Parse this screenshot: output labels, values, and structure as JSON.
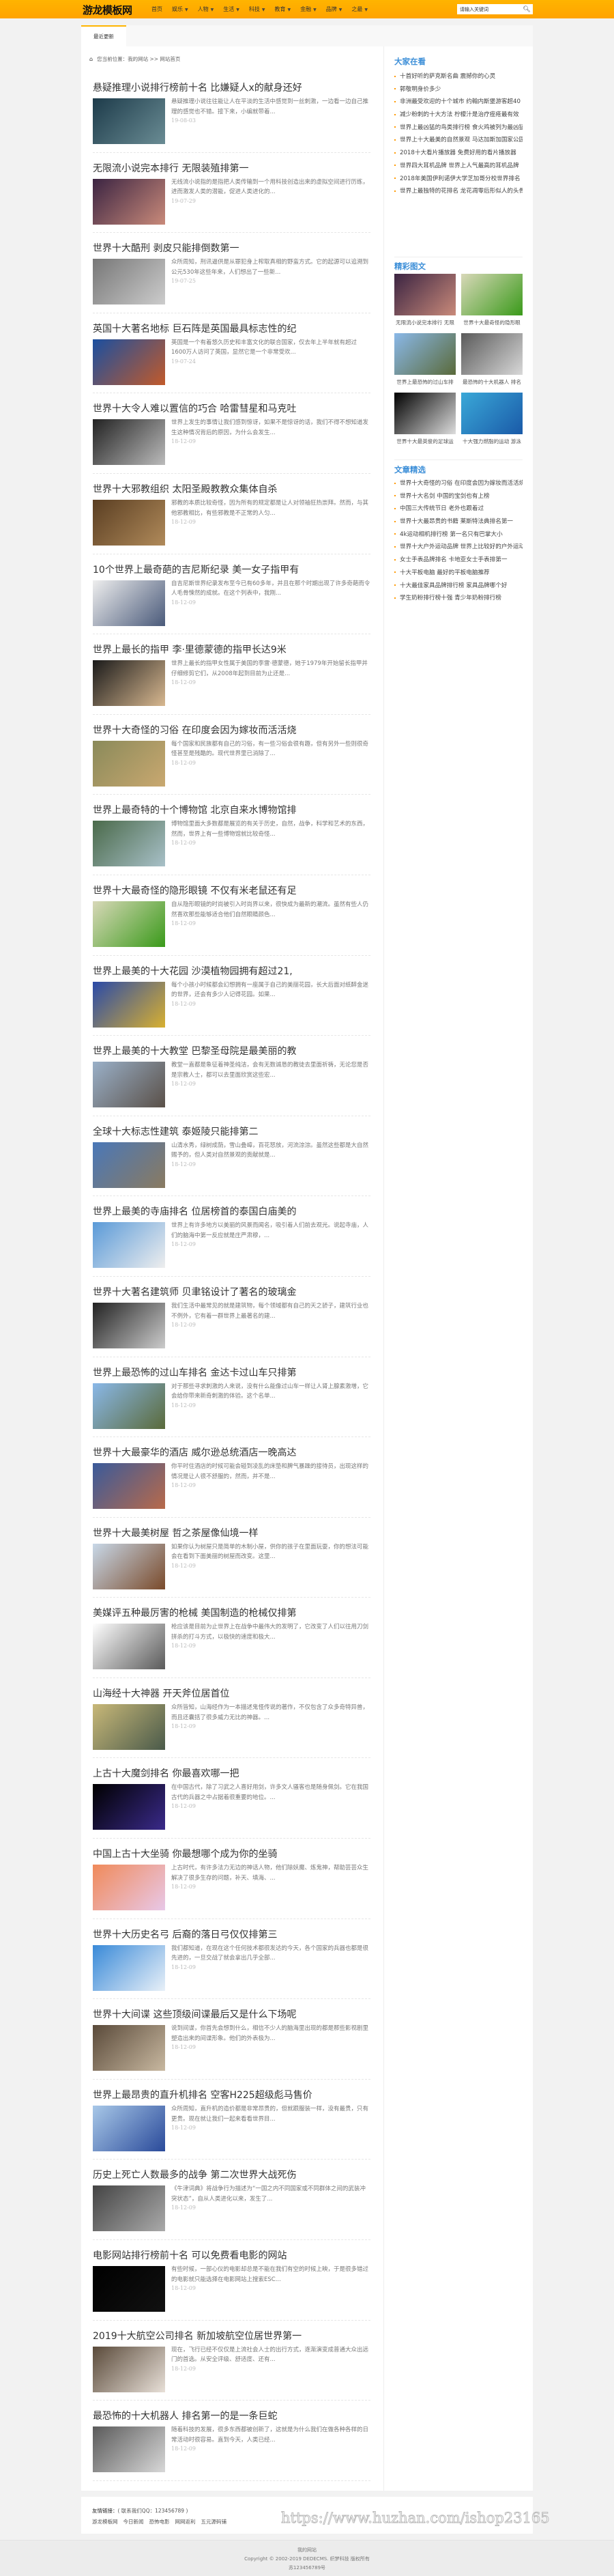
{
  "header": {
    "logo": "游龙模板网",
    "nav": [
      {
        "label": "首页",
        "dropdown": false
      },
      {
        "label": "娱乐",
        "dropdown": true
      },
      {
        "label": "人物",
        "dropdown": true
      },
      {
        "label": "生活",
        "dropdown": true
      },
      {
        "label": "科技",
        "dropdown": true
      },
      {
        "label": "教育",
        "dropdown": true
      },
      {
        "label": "金融",
        "dropdown": true
      },
      {
        "label": "品牌",
        "dropdown": true
      },
      {
        "label": "之最",
        "dropdown": true
      }
    ],
    "search_placeholder": "请输入关键词",
    "accent": "#ffb400"
  },
  "tabs": {
    "active": "最近更新"
  },
  "breadcrumb": {
    "text": "您当前位置：我的网站 >> 网站首页"
  },
  "articles": [
    {
      "title": "悬疑推理小说排行榜前十名 比嫌疑人x的献身还好",
      "excerpt": "悬疑推理小说往往能让人在平淡的生活中感觉到一丝刺激，一边看一边自己推理的感觉也不错。接下来，小编就带着...",
      "date": "19-08-03",
      "colors": [
        "#1d3b4a",
        "#6a8c94"
      ]
    },
    {
      "title": "无限流小说完本排行 无限装殖排第一",
      "excerpt": "无线流小说指的是指把人类传输到一个用科技创造出来的虚拟空间进行历练，进而激发人类的潜能，促进人类进化的...",
      "date": "19-07-29",
      "colors": [
        "#3b2442",
        "#c98a7a"
      ]
    },
    {
      "title": "世界十大酷刑 剥皮只能排倒数第一",
      "excerpt": "众所周知，刑讯逼供是从罪犯身上榨取真相的野蛮方式。它的起源可以追溯到公元530年这些年来，人们想出了一些新...",
      "date": "19-07-25",
      "colors": [
        "#777",
        "#ccc"
      ]
    },
    {
      "title": "英国十大著名地标 巨石阵是英国最具标志性的纪",
      "excerpt": "英国是一个有着悠久历史和丰富文化的联合国家，仅去年上半年就有超过1600万人访问了英国，显然它是一个非常受欢...",
      "date": "19-07-24",
      "colors": [
        "#1a4fa0",
        "#c25a2a"
      ]
    },
    {
      "title": "世界十大令人难以置信的巧合 哈雷彗星和马克吐",
      "excerpt": "世界上发生的事情让我们感到惊讶，如果不是惊讶的话，我们不得不想知道发生这种情况背后的原因，为什么会发生...",
      "date": "18-12-09",
      "colors": [
        "#222",
        "#bbb"
      ]
    },
    {
      "title": "世界十大邪教组织 太阳圣殿教教众集体自杀",
      "excerpt": "邪教的本质比较奇怪，因为所有的规定都是让人对领袖狂热崇拜。然而，与其他邪教相比，有些邪教是不正常的人匀...",
      "date": "18-12-09",
      "colors": [
        "#5a3e22",
        "#b08a5a"
      ]
    },
    {
      "title": "10个世界上最奇葩的吉尼斯纪录 美一女子指甲有",
      "excerpt": "自吉尼斯世界纪录发布至今已有60多年，并且在那个时期出现了许多奇葩而令人毛骨悚然的成就。在这个列表中，我刚...",
      "date": "18-12-09",
      "colors": [
        "#eee",
        "#4a5a7a"
      ]
    },
    {
      "title": "世界上最长的指甲 李·里德蒙德的指甲长达9米",
      "excerpt": "世界上最长的指甲女性属于美国的李雷·德蒙德，她于1979年开始留长指甲并仔细修剪它们，从2008年起到目前为止还是...",
      "date": "18-12-09",
      "colors": [
        "#1a1a1a",
        "#d8b890"
      ]
    },
    {
      "title": "世界十大奇怪的习俗 在印度会因为嫁妆而活活烧",
      "excerpt": "每个国家和民族都有自己的习俗，有一些习俗会很有趣，但有另外一些则很奇怪甚至是残酷的。现代世界里已消除了...",
      "date": "18-12-09",
      "colors": [
        "#8a8a5a",
        "#c9a870"
      ]
    },
    {
      "title": "世界上最奇特的十个博物馆 北京自来水博物馆排",
      "excerpt": "博物馆里面大多数都是展览的有关于历史，自然，战争，科学和艺术的东西，然而，世界上有一些博物馆就比较奇怪...",
      "date": "18-12-09",
      "colors": [
        "#4a6a4a",
        "#a8c0c8"
      ]
    },
    {
      "title": "世界十大最奇怪的隐形眼镜 不仅有米老鼠还有足",
      "excerpt": "自从隐形眼镜的时尚被引入时尚界以来，很快成为最新的潮流。虽然有些人仍然喜欢那些能够适合他们自然眼睛颜色...",
      "date": "18-12-09",
      "colors": [
        "#d8d8b8",
        "#3a9a1a"
      ]
    },
    {
      "title": "世界上最美的十大花园 沙漠植物园拥有超过21,",
      "excerpt": "每个小孩小时候都会幻想拥有一座属于自己的美丽花园，长大后面对纸醉金迷的世界，还会有多少人记得花园。如果...",
      "date": "18-12-09",
      "colors": [
        "#2a4aa8",
        "#d8b030"
      ]
    },
    {
      "title": "世界上最美的十大教堂 巴黎圣母院是最美丽的教",
      "excerpt": "教堂一直都是象征着神圣纯洁，会有无数诚恳的教徒去里面祈祷，无论您是否是宗教人士，都可以去里面欣赏这些宏...",
      "date": "18-12-09",
      "colors": [
        "#9ab0c8",
        "#5a5048"
      ]
    },
    {
      "title": "全球十大标志性建筑 泰姬陵只能排第二",
      "excerpt": "山清水秀，绿树成荫，雪山叠嶂，百花怒放，河流淙淙。虽然这些都是大自然赐予的，但人类对自然景观的贡献就是...",
      "date": "18-12-09",
      "colors": [
        "#4a78b8",
        "#8a7a60"
      ]
    },
    {
      "title": "世界上最美的寺庙排名 位居榜首的泰国白庙美的",
      "excerpt": "世界上有许多地方以美丽的风景而闻名，吸引着人们前去观光。说起寺庙，人们的脑海中第一反应就是庄严肃穆，...",
      "date": "18-12-09",
      "colors": [
        "#5a9ad8",
        "#eeeeee"
      ]
    },
    {
      "title": "世界十大著名建筑师 贝聿铭设计了著名的玻璃金",
      "excerpt": "我们生活中最常见的就是建筑物，每个领域都有自己的天之骄子，建筑行业也不例外，它有着一群世界上最著名的建...",
      "date": "18-12-09",
      "colors": [
        "#222",
        "#ccc"
      ]
    },
    {
      "title": "世界上最恐怖的过山车排名 金达卡过山车只排第",
      "excerpt": "对于那些寻求刺激的人来说，没有什么能像过山车一样让人肾上腺素激增，它会给你带来新奇刺激的体验。这个名单...",
      "date": "18-12-09",
      "colors": [
        "#8ab8e8",
        "#5a6a3a"
      ]
    },
    {
      "title": "世界十大最豪华的酒店 威尔逊总统酒店一晚高达",
      "excerpt": "你平时住酒店的时候可能会碰到凌乱的床垫和脾气暴躁的接待员，出现这样的情况是让人很不舒服的，然而，并不是...",
      "date": "18-12-09",
      "colors": [
        "#3a5a9a",
        "#b86a4a"
      ]
    },
    {
      "title": "世界十大最美树屋 哲之茶屋像仙境一样",
      "excerpt": "如果你认为树屋只是简单的木制小屋，供你的孩子在里面玩耍，你的想法可能会在看到下面美丽的树屋而改变。这里...",
      "date": "18-12-09",
      "colors": [
        "#c8d8e8",
        "#7a4a2a"
      ]
    },
    {
      "title": "美媒评五种最厉害的枪械 美国制造的枪械仅排第",
      "excerpt": "枪应该是目前为止世界上在战争中最伟大的发明了，它改变了人们以往用刀剑拼杀的打斗方式，以极快的速度和极大...",
      "date": "18-12-09",
      "colors": [
        "#ffffff",
        "#5a5a5a"
      ]
    },
    {
      "title": "山海经十大神器 开天斧位居首位",
      "excerpt": "众所皆知，山海经作为一本描述鬼怪传说的著作，不仅包含了众多奇特异兽，而且还囊括了很多威力无比的神器。...",
      "date": "18-12-09",
      "colors": [
        "#c8b878",
        "#4a5a4a"
      ]
    },
    {
      "title": "上古十大魔剑排名 你最喜欢哪一把",
      "excerpt": "在中国古代，除了习武之人喜好用剑，许多文人骚客也是随身佩剑。它在我国古代的兵器之中占据着很重要的地位。...",
      "date": "18-12-09",
      "colors": [
        "#000000",
        "#3a2a8a"
      ]
    },
    {
      "title": "中国上古十大坐骑 你最想哪个成为你的坐骑",
      "excerpt": "上古时代，有许多法力无边的神话人物，他们除妖魔、炼鬼神，帮助芸芸众生解决了很多生存的问题，补天、填海、...",
      "date": "18-12-09",
      "colors": [
        "#f08a5a",
        "#e8c8e8"
      ]
    },
    {
      "title": "世界十大历史名弓 后裔的落日弓仅仅排第三",
      "excerpt": "我们都知道，在现在这个任何技术都很发达的今天，各个国家的兵器也都是很先进的，一旦交战了就会拿出几乎全部...",
      "date": "18-12-09",
      "colors": [
        "#3a8ad8",
        "#e8f0f8"
      ]
    },
    {
      "title": "世界十大间谍 这些顶级间谍最后又是什么下场呢",
      "excerpt": "说到间谍，你首先会想到什么，相信不少人的脑海里出现的都是那些影视剧里塑造出来的间谍形象。他们的外表极为...",
      "date": "18-12-09",
      "colors": [
        "#5a4a3a",
        "#c8b8a0"
      ]
    },
    {
      "title": "世界上最昂贵的直升机排名 空客H225超级彪马售价",
      "excerpt": "众所周知，直升机的造价都是非常昂贵的，但就跟服装一样，没有最贵，只有更贵。现在就让我们一起来看看世界目...",
      "date": "18-12-09",
      "colors": [
        "#a8c8e8",
        "#2a4a9a"
      ]
    },
    {
      "title": "历史上死亡人数最多的战争 第二次世界大战死伤",
      "excerpt": "《牛津词典》将战争行为描述为“一国之内不同国家或不同群体之间的武装冲突状态”，自从人类进化以来，发生了...",
      "date": "18-12-09",
      "colors": [
        "#444",
        "#aaa"
      ]
    },
    {
      "title": "电影网站排行榜前十名 可以免费看电影的网站",
      "excerpt": "有些时候，一部心仪的电影却总是不能在我们有空的时候上映，于是很多错过的电影就只能选择在电影网站上搜索ESC...",
      "date": "18-12-09",
      "colors": [
        "#000000",
        "#111111"
      ]
    },
    {
      "title": "2019十大航空公司排名 新加坡航空位居世界第一",
      "excerpt": "现在，飞行已经不仅仅是上流社会人士的出行方式，逐渐演变成普通大众出远门的首选。从安全评级、舒适度、还有...",
      "date": "18-12-09",
      "colors": [
        "#5a4a3a",
        "#e8e0d8"
      ]
    },
    {
      "title": "最恐怖的十大机器人 排名第一的是一条巨蛇",
      "excerpt": "随着科技的发展，很多东西都被创新了，这就是为什么我们在做各种各样的日常活动时很容易。直到今天，人类已经...",
      "date": "18-12-09",
      "colors": [
        "#5a5a5a",
        "#d8d8d8"
      ]
    }
  ],
  "sidebar": {
    "popular": {
      "title": "大家在看",
      "items": [
        "十首好听的萨克斯名曲 震撼你的心灵",
        "郭敬明身价多少",
        "非洲最受欢迎的十个城市 约翰内斯堡游客超40",
        "减少粉刺的十大方法 柠檬汁是治疗痤疮最有效",
        "世界上最凶猛的鸟类排行榜 食火鸡被列为最凶猛",
        "世界上十大最美的自然景观 马达加斯加国家公园",
        "2018十大看片播放器 免费好用的看片播放器",
        "世界四大耳机品牌 世界上人气最高的耳机品牌",
        "2018年美国伊利诺伊大学芝加哥分校世界排名",
        "世界上最独特的花排名 龙花凋零后形似人的头骨"
      ]
    },
    "gallery": {
      "title": "精彩图文",
      "items": [
        {
          "caption": "无限流小说完本排行 无限",
          "colors": [
            "#3b2442",
            "#c98a7a"
          ]
        },
        {
          "caption": "世界十大最奇怪的隐形眼",
          "colors": [
            "#d8d8b8",
            "#3a9a1a"
          ]
        },
        {
          "caption": "世界上最恐怖的过山车排",
          "colors": [
            "#8ab8e8",
            "#5a6a3a"
          ]
        },
        {
          "caption": "最恐怖的十大机器人 排名",
          "colors": [
            "#5a5a5a",
            "#d8d8d8"
          ]
        },
        {
          "caption": "世界十大最英俊的足球运",
          "colors": [
            "#000000",
            "#dddddd"
          ]
        },
        {
          "caption": "十大强力燃脂的运动 游泳",
          "colors": [
            "#3aa8d8",
            "#1a5aa8"
          ]
        }
      ]
    },
    "featured": {
      "title": "文章精选",
      "items": [
        "世界十大奇怪的习俗 在印度会因为嫁妆而活活烧",
        "世界十大名剑 中国的宝剑也有上榜",
        "中国三大传统节日 老外也跟着过",
        "世界十大最昂贵的书籍 莱斯特法典排名第一",
        "4k运动相机排行榜 第一名只有巴掌大小",
        "世界十大户外运动品牌 世界上比较好的户外运动品牌",
        "女士手表品牌排名 卡地亚女士手表排第一",
        "十大平板电脑 最好的平板电脑推荐",
        "十大最佳家具品牌排行榜 家具品牌哪个好",
        "学生奶粉排行榜十强 青少年奶粉排行榜"
      ]
    }
  },
  "links": {
    "label": "友情链接：",
    "contact": "( 联系我们QQ：123456789 )",
    "items": [
      "游龙模板网",
      "今日新闻",
      "恐怖电影",
      "网网返利",
      "五元源码铺"
    ]
  },
  "watermark": "https://www.huzhan.com/ishop23165",
  "footer": {
    "site": "我的网站",
    "copyright": "Copyright © 2002-2019 DEDECMS. 织梦科技 版权所有",
    "icp": "苏123456789号"
  }
}
